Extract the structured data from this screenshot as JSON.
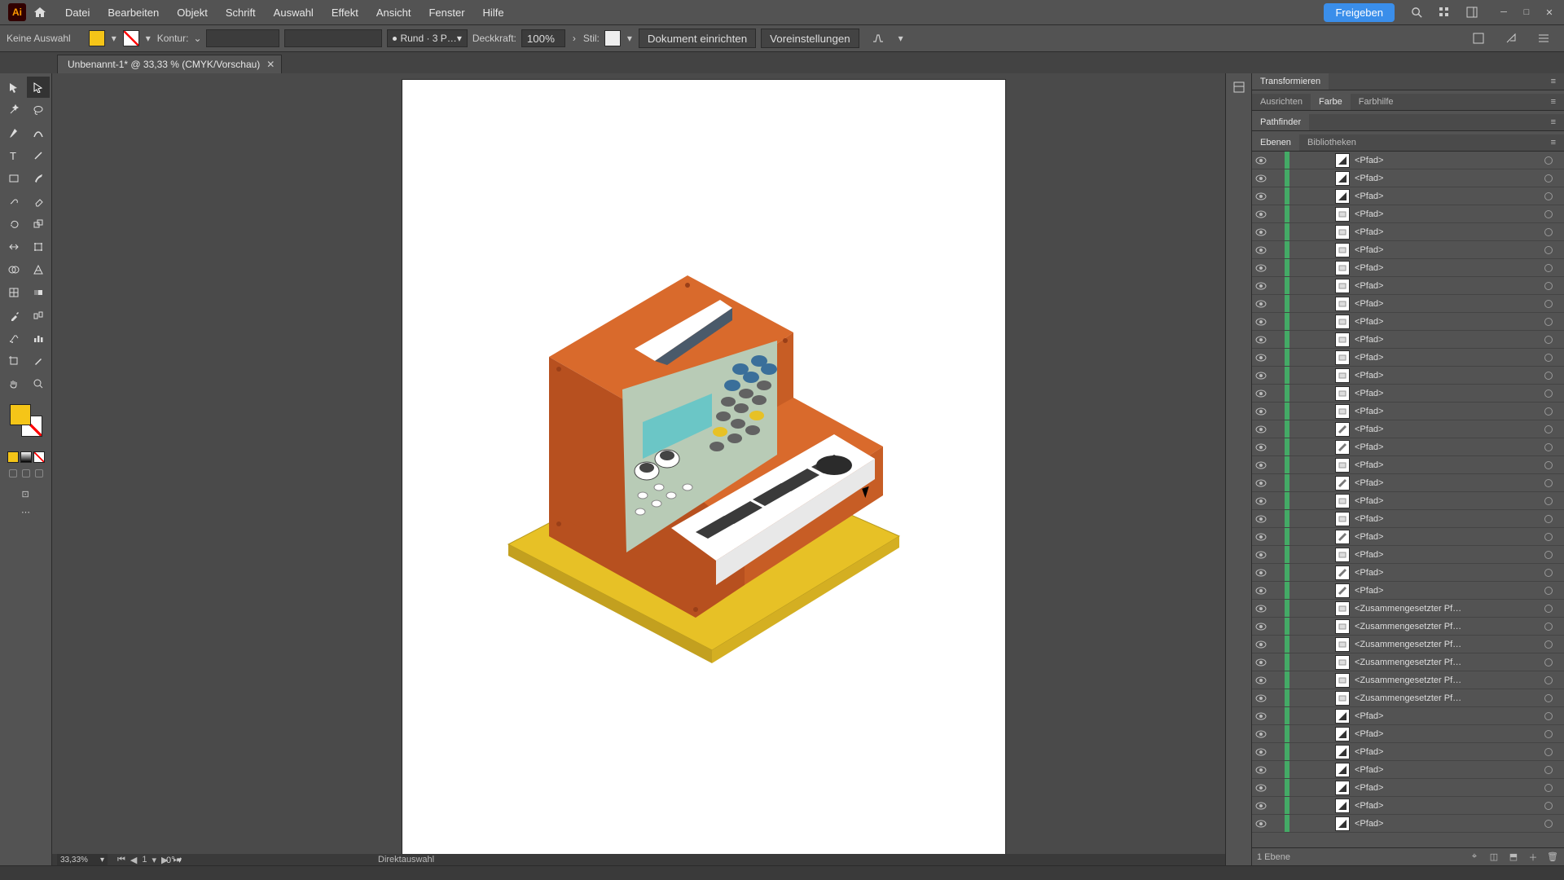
{
  "app": {
    "initials": "Ai"
  },
  "menu": [
    "Datei",
    "Bearbeiten",
    "Objekt",
    "Schrift",
    "Auswahl",
    "Effekt",
    "Ansicht",
    "Fenster",
    "Hilfe"
  ],
  "share_label": "Freigeben",
  "control": {
    "selection": "Keine Auswahl",
    "kontur_label": "Kontur:",
    "stroke_profile": "Rund · 3 P…",
    "deckkraft_label": "Deckkraft:",
    "deckkraft_value": "100%",
    "stil_label": "Stil:",
    "doc_setup": "Dokument einrichten",
    "prefs": "Voreinstellungen"
  },
  "tab": {
    "title": "Unbenannt-1* @ 33,33 % (CMYK/Vorschau)"
  },
  "status": {
    "zoom": "33,33%",
    "angle": "0°",
    "page": "1",
    "tool": "Direktauswahl"
  },
  "panels": {
    "group1": [
      "Transformieren"
    ],
    "group2": [
      "Ausrichten",
      "Farbe",
      "Farbhilfe"
    ],
    "group2_active": 1,
    "group3": [
      "Pathfinder"
    ],
    "group4": [
      "Ebenen",
      "Bibliotheken"
    ],
    "group4_active": 0
  },
  "layers": {
    "footer_count": "1 Ebene",
    "items": [
      {
        "name": "<Pfad>",
        "shape": "tri-dark"
      },
      {
        "name": "<Pfad>",
        "shape": "tri-dark"
      },
      {
        "name": "<Pfad>",
        "shape": "tri-dark"
      },
      {
        "name": "<Pfad>",
        "shape": "rect-white"
      },
      {
        "name": "<Pfad>",
        "shape": "rect-white"
      },
      {
        "name": "<Pfad>",
        "shape": "rect-white"
      },
      {
        "name": "<Pfad>",
        "shape": "rect-white"
      },
      {
        "name": "<Pfad>",
        "shape": "rect-white"
      },
      {
        "name": "<Pfad>",
        "shape": "rect-white"
      },
      {
        "name": "<Pfad>",
        "shape": "rect-white"
      },
      {
        "name": "<Pfad>",
        "shape": "rect-white"
      },
      {
        "name": "<Pfad>",
        "shape": "rect-white"
      },
      {
        "name": "<Pfad>",
        "shape": "rect-white"
      },
      {
        "name": "<Pfad>",
        "shape": "rect-white"
      },
      {
        "name": "<Pfad>",
        "shape": "rect-white"
      },
      {
        "name": "<Pfad>",
        "shape": "diag"
      },
      {
        "name": "<Pfad>",
        "shape": "diag"
      },
      {
        "name": "<Pfad>",
        "shape": "rect-white"
      },
      {
        "name": "<Pfad>",
        "shape": "diag"
      },
      {
        "name": "<Pfad>",
        "shape": "rect-white"
      },
      {
        "name": "<Pfad>",
        "shape": "rect-white"
      },
      {
        "name": "<Pfad>",
        "shape": "diag"
      },
      {
        "name": "<Pfad>",
        "shape": "rect-white"
      },
      {
        "name": "<Pfad>",
        "shape": "diag"
      },
      {
        "name": "<Pfad>",
        "shape": "diag"
      },
      {
        "name": "<Zusammengesetzter Pf…",
        "shape": "rect-white"
      },
      {
        "name": "<Zusammengesetzter Pf…",
        "shape": "rect-white"
      },
      {
        "name": "<Zusammengesetzter Pf…",
        "shape": "rect-white"
      },
      {
        "name": "<Zusammengesetzter Pf…",
        "shape": "rect-white"
      },
      {
        "name": "<Zusammengesetzter Pf…",
        "shape": "rect-white"
      },
      {
        "name": "<Zusammengesetzter Pf…",
        "shape": "rect-white"
      },
      {
        "name": "<Pfad>",
        "shape": "tri-dark"
      },
      {
        "name": "<Pfad>",
        "shape": "tri-dark"
      },
      {
        "name": "<Pfad>",
        "shape": "tri-dark"
      },
      {
        "name": "<Pfad>",
        "shape": "tri-dark"
      },
      {
        "name": "<Pfad>",
        "shape": "tri-dark"
      },
      {
        "name": "<Pfad>",
        "shape": "tri-dark"
      },
      {
        "name": "<Pfad>",
        "shape": "tri-dark"
      }
    ]
  },
  "colors": {
    "accent": "#3a8eea",
    "fill": "#f5c518",
    "synth_orange": "#d96a2c",
    "synth_orange_dark": "#b7501f",
    "synth_panel": "#b8cbb6",
    "synth_teal": "#6bc6c6",
    "synth_yellow": "#e7c126",
    "synth_blue": "#3a6f9a",
    "key_white": "#ffffff",
    "key_black": "#3a3a3a"
  }
}
